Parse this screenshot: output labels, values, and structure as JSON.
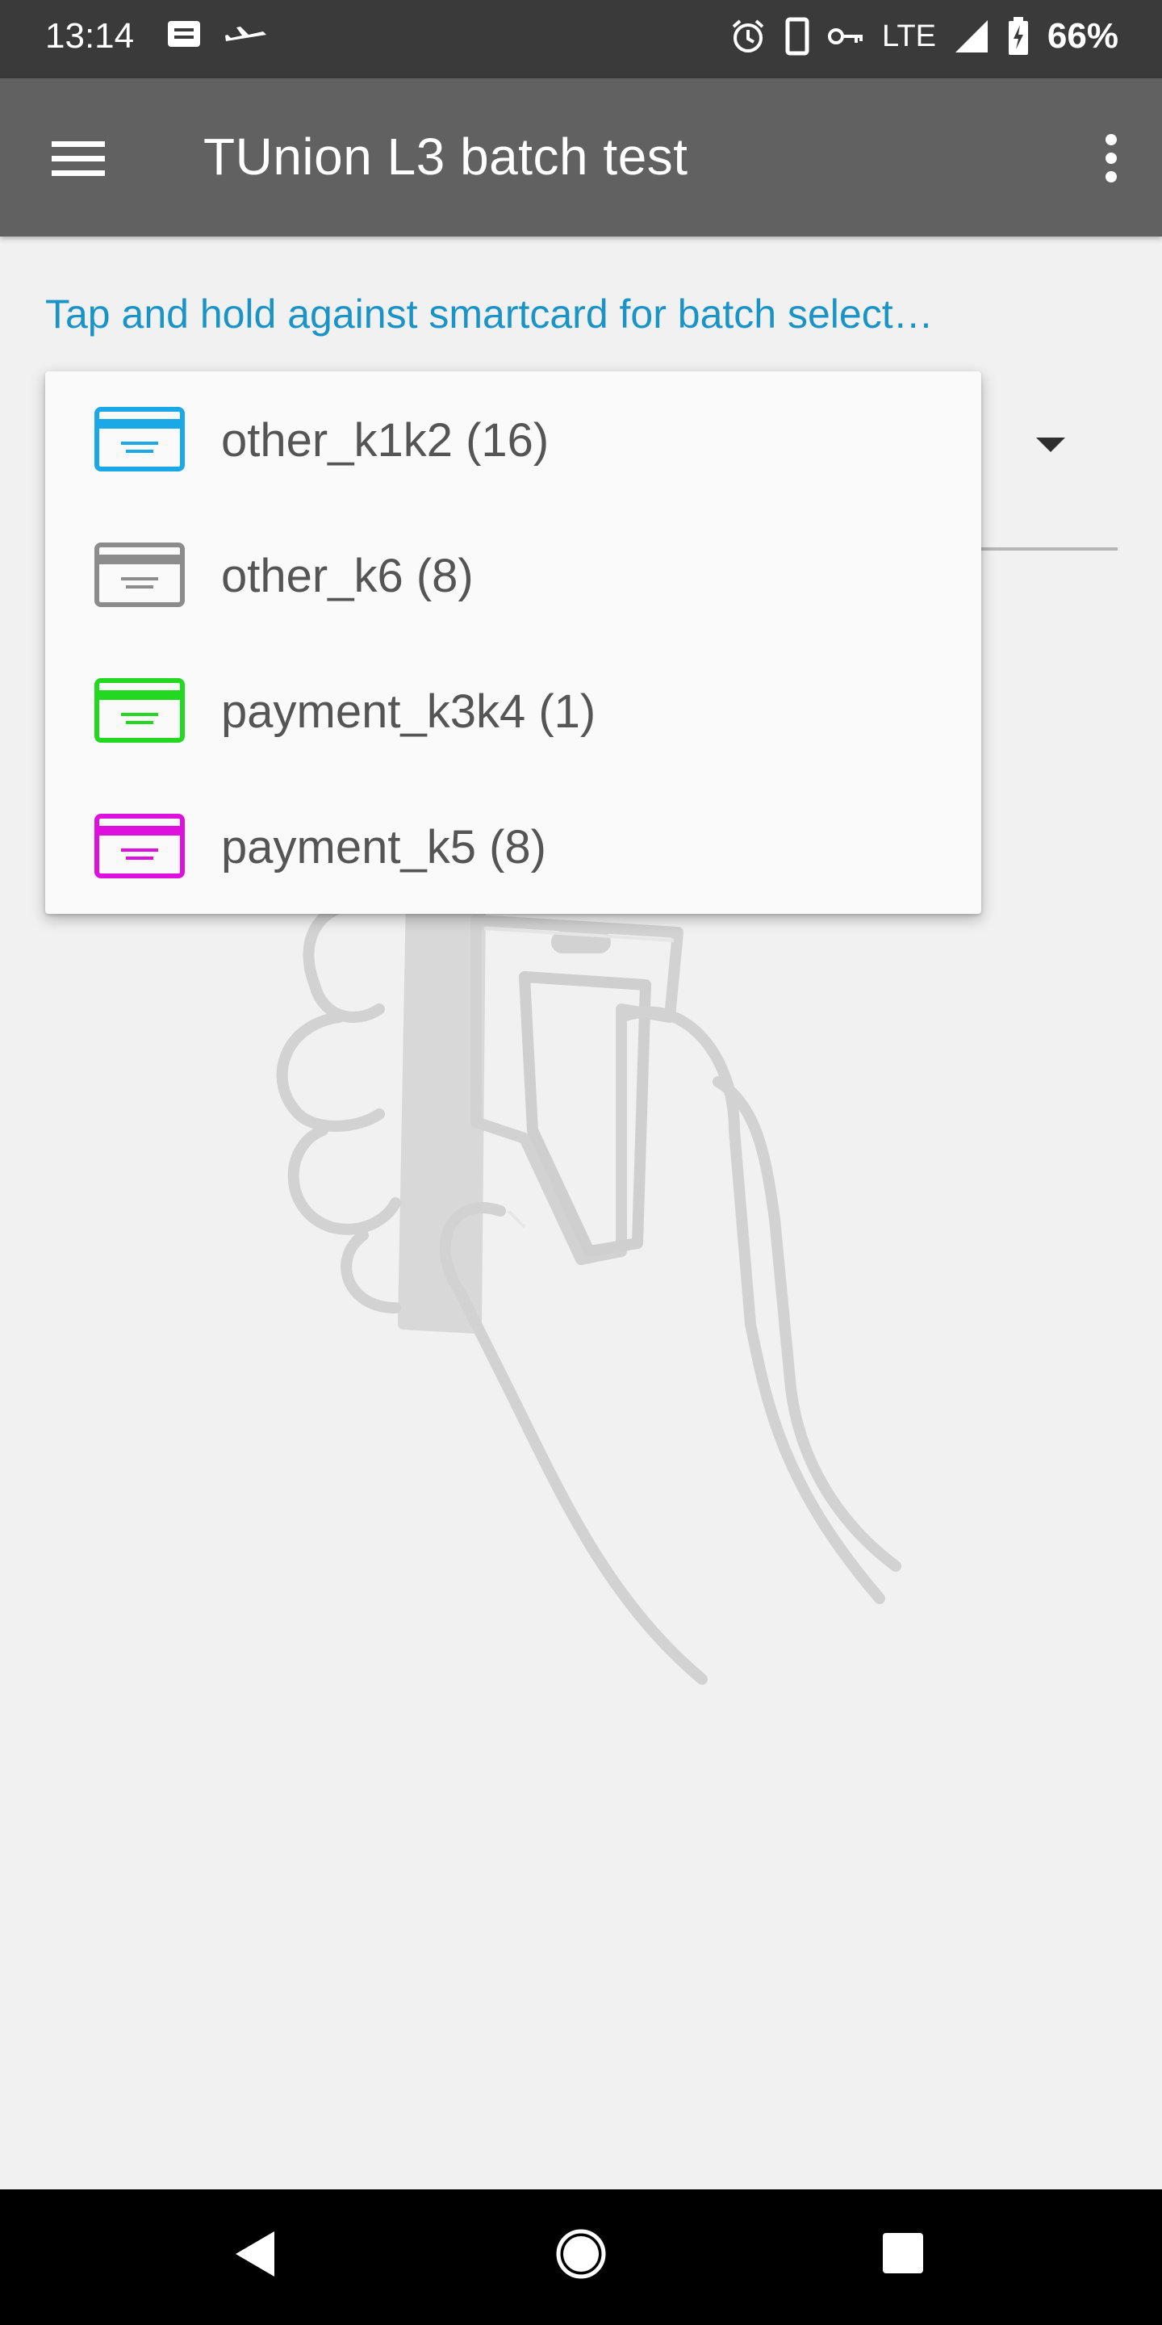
{
  "status_bar": {
    "time": "13:14",
    "network": "LTE",
    "battery_percent": "66%",
    "left_icons": [
      "message-icon",
      "flight-icon"
    ],
    "right_icons": [
      "alarm-icon",
      "phone-icon",
      "vpn-key-icon",
      "signal-icon",
      "battery-charging-icon"
    ]
  },
  "app_bar": {
    "title": "TUnion L3 batch test",
    "menu_icon": "hamburger-menu-icon",
    "overflow_icon": "more-vert-icon"
  },
  "hint": {
    "text": "Tap and hold against smartcard for batch select…",
    "color": "#1a93c7"
  },
  "dropdown": {
    "items": [
      {
        "label": "other_k1k2 (16)",
        "icon": "card-icon",
        "color": "#1aa9e6"
      },
      {
        "label": "other_k6 (8)",
        "icon": "card-icon",
        "color": "#8c8c8c"
      },
      {
        "label": "payment_k3k4 (1)",
        "icon": "card-icon",
        "color": "#22d820"
      },
      {
        "label": "payment_k5 (8)",
        "icon": "card-icon",
        "color": "#dd10dd"
      }
    ]
  },
  "nav_bar": {
    "icons": [
      "back-icon",
      "home-icon",
      "recents-icon"
    ]
  }
}
